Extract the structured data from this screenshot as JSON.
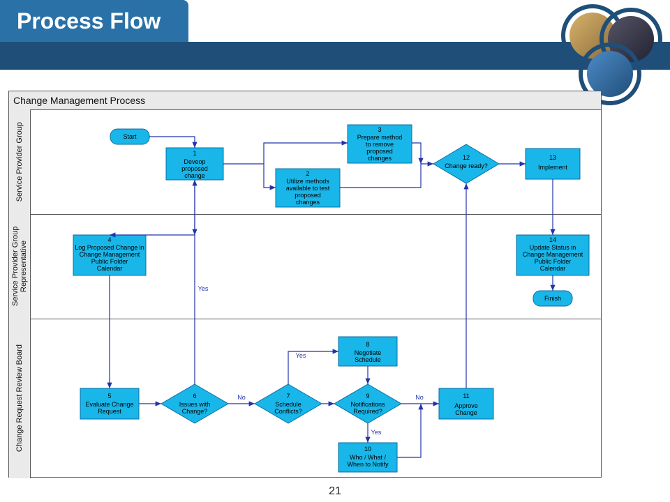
{
  "header": {
    "title": "Process Flow"
  },
  "page_number": "21",
  "diagram": {
    "title": "Change Management Process",
    "lanes": [
      {
        "label": "Service Provider Group"
      },
      {
        "label": "Service Provider Group Representative"
      },
      {
        "label": "Change Request Review Board"
      }
    ],
    "nodes": {
      "start": "Start",
      "n1_num": "1",
      "n1": "Deveop proposed change",
      "n2_num": "2",
      "n2": "Utilize methods available to test proposed changes",
      "n3_num": "3",
      "n3": "Prepare method to remove proposed changes",
      "n4_num": "4",
      "n4": "Log Proposed Change in Change Management Public Folder Calendar",
      "n5_num": "5",
      "n5": "Evaluate Change Request",
      "n6_num": "6",
      "n6": "Issues with Change?",
      "n7_num": "7",
      "n7": "Schedule Conflicts?",
      "n8_num": "8",
      "n8": "Negotiate Schedule",
      "n9_num": "9",
      "n9": "Notifications Required?",
      "n10_num": "10",
      "n10": "Who / What / When to Notify",
      "n11_num": "11",
      "n11": "Approve Change",
      "n12_num": "12",
      "n12": "Change ready?",
      "n13_num": "13",
      "n13": "Implement",
      "n14_num": "14",
      "n14": "Update Status in Change Management Public Folder Calendar",
      "finish": "Finish"
    },
    "edge_labels": {
      "yes": "Yes",
      "no": "No"
    }
  }
}
